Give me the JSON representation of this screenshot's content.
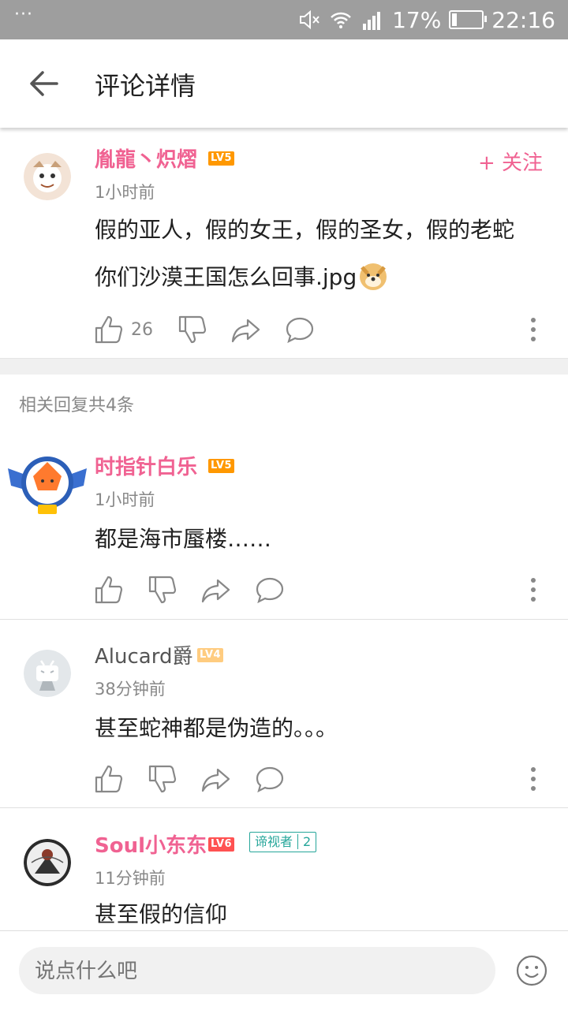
{
  "status_bar": {
    "battery": "17%",
    "time": "22:16",
    "dots": "···"
  },
  "header": {
    "title": "评论详情"
  },
  "main_comment": {
    "username": "胤龍丶炽熠",
    "level": "LV5",
    "time": "1小时前",
    "follow_label": "+ 关注",
    "line1": "假的亚人，假的女王，假的圣女，假的老蛇",
    "line2": "你们沙漠王国怎么回事.jpg",
    "likes": "26"
  },
  "replies_header": "相关回复共4条",
  "replies": [
    {
      "username": "时指针白乐",
      "level": "LV5",
      "time": "1小时前",
      "text": "都是海市蜃楼……"
    },
    {
      "username": "Alucard爵",
      "level": "LV4",
      "time": "38分钟前",
      "text": "甚至蛇神都是伪造的。。。"
    },
    {
      "username": "Soul小东东",
      "level": "LV6",
      "badge": "谛视者",
      "badge_num": "2",
      "time": "11分钟前",
      "text": "甚至假的信仰"
    }
  ],
  "input": {
    "placeholder": "说点什么吧"
  },
  "icons": {
    "back": "arrow-left-icon",
    "like": "thumbs-up-icon",
    "dislike": "thumbs-down-icon",
    "share": "share-icon",
    "comment": "comment-icon",
    "more": "more-vert-icon",
    "emoji": "smiley-icon"
  },
  "colors": {
    "accent": "#f06292",
    "status_bar": "#9e9e9e"
  }
}
